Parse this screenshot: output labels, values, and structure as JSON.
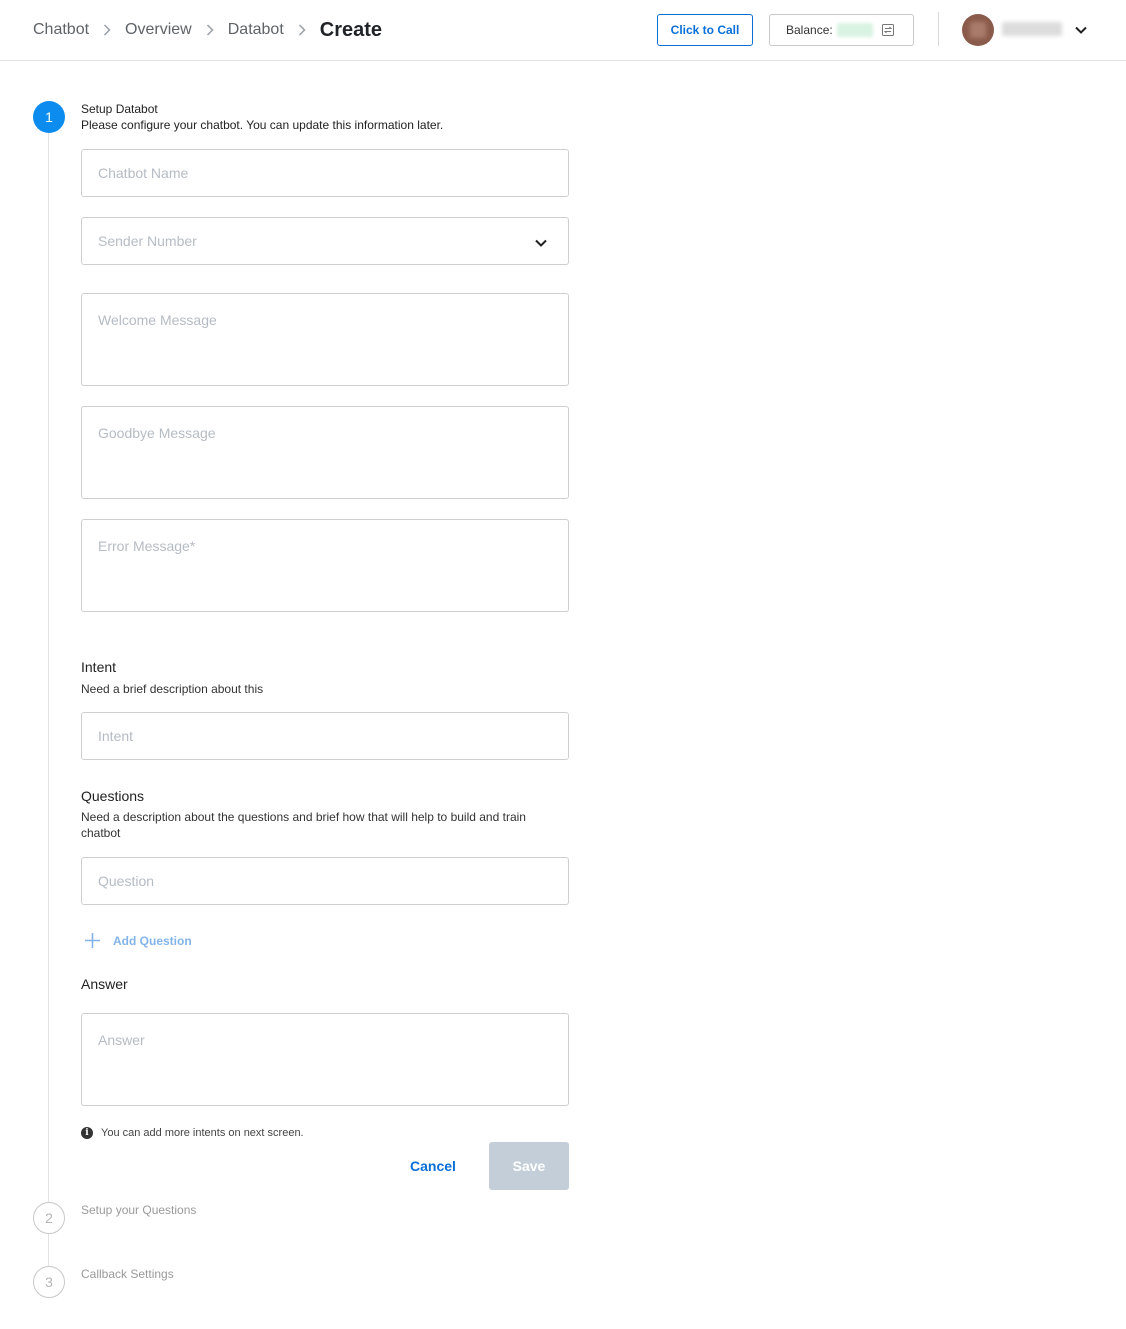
{
  "breadcrumb": {
    "items": [
      "Chatbot",
      "Overview",
      "Databot"
    ],
    "current": "Create"
  },
  "header": {
    "click_to_call": "Click to Call",
    "balance_label": "Balance:"
  },
  "stepper": {
    "steps": [
      {
        "number": "1",
        "title": "Setup Databot",
        "subtitle": "Please configure your chatbot. You can update this information later."
      },
      {
        "number": "2",
        "title": "Setup your Questions"
      },
      {
        "number": "3",
        "title": "Callback Settings"
      }
    ]
  },
  "form": {
    "chatbot_name_placeholder": "Chatbot Name",
    "sender_number_placeholder": "Sender Number",
    "welcome_message_placeholder": "Welcome Message",
    "goodbye_message_placeholder": "Goodbye Message",
    "error_message_placeholder": "Error Message*",
    "intent": {
      "title": "Intent",
      "description": "Need a brief description about this",
      "placeholder": "Intent"
    },
    "questions": {
      "title": "Questions",
      "description": "Need a description about the questions and brief how that will help to build and train chatbot",
      "placeholder": "Question",
      "add_label": "Add Question"
    },
    "answer": {
      "title": "Answer",
      "placeholder": "Answer"
    },
    "info_note": "You can add more intents on next screen.",
    "cancel_label": "Cancel",
    "save_label": "Save"
  },
  "colors": {
    "accent": "#0a6fd6",
    "step_active": "#0d8cf0",
    "save_disabled": "#c3ced8"
  }
}
